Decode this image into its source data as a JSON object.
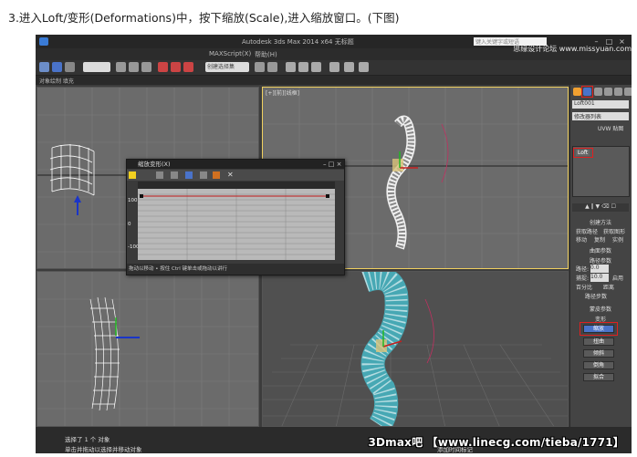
{
  "caption": "3.进入Loft/变形(Deformations)中，按下缩放(Scale),进入缩放窗口。(下图)",
  "app": {
    "title": "Autodesk 3ds Max 2014 x64    无标题",
    "search_placeholder": "键入关键字或短语",
    "menu": [
      "MAXScript(X)",
      "帮助(H)"
    ],
    "selection_set": "创建选择集",
    "ribbon_label": "对象绘制    填充"
  },
  "viewports": {
    "top_left_label": "",
    "top_right_label": "[+][前][线框]",
    "bottom_left_label": "",
    "bottom_right_label": ""
  },
  "command_panel": {
    "object_name": "Loft001",
    "modifier_list": "修改器列表",
    "stack_item": "Loft",
    "uvw": "UVW 贴图",
    "rollouts": {
      "creation_method": "创建方法",
      "get_path": "获取路径",
      "get_shape": "获取图形",
      "move": "移动",
      "copy": "复制",
      "instance": "实例",
      "surface_params": "曲面参数",
      "path_params": "路径参数",
      "path_label": "路径:",
      "path_value": "0.0",
      "snap_label": "捕捉:",
      "snap_value": "10.0",
      "enable": "启用",
      "percent": "百分比",
      "distance": "距离",
      "path_steps": "路径步数",
      "skin_params": "蒙皮参数",
      "deformations": "变形",
      "scale": "缩放",
      "twist": "扭曲",
      "teeter": "倾斜",
      "bevel": "倒角",
      "fit": "拟合"
    }
  },
  "scale_dialog": {
    "title": "缩放变形(X)",
    "y_ticks": [
      "100",
      "0",
      "-100"
    ],
    "status": "拖动以移动 • 按住 Ctrl 键单击或拖动以讲行"
  },
  "status": {
    "line1": "选择了 1 个 对象",
    "line2": "单击并拖动以选择并移动对象",
    "grid": "添加时间标记"
  },
  "watermark": "3Dmax吧 【www.linecg.com/tieba/1771】",
  "corner_watermark": "思缘设计论坛  www.missyuan.com",
  "colors": {
    "highlight": "#e02020",
    "active_button": "#4a73c9",
    "viewport_bg": "#6b6b6b",
    "perspective_bg": "#505050"
  }
}
